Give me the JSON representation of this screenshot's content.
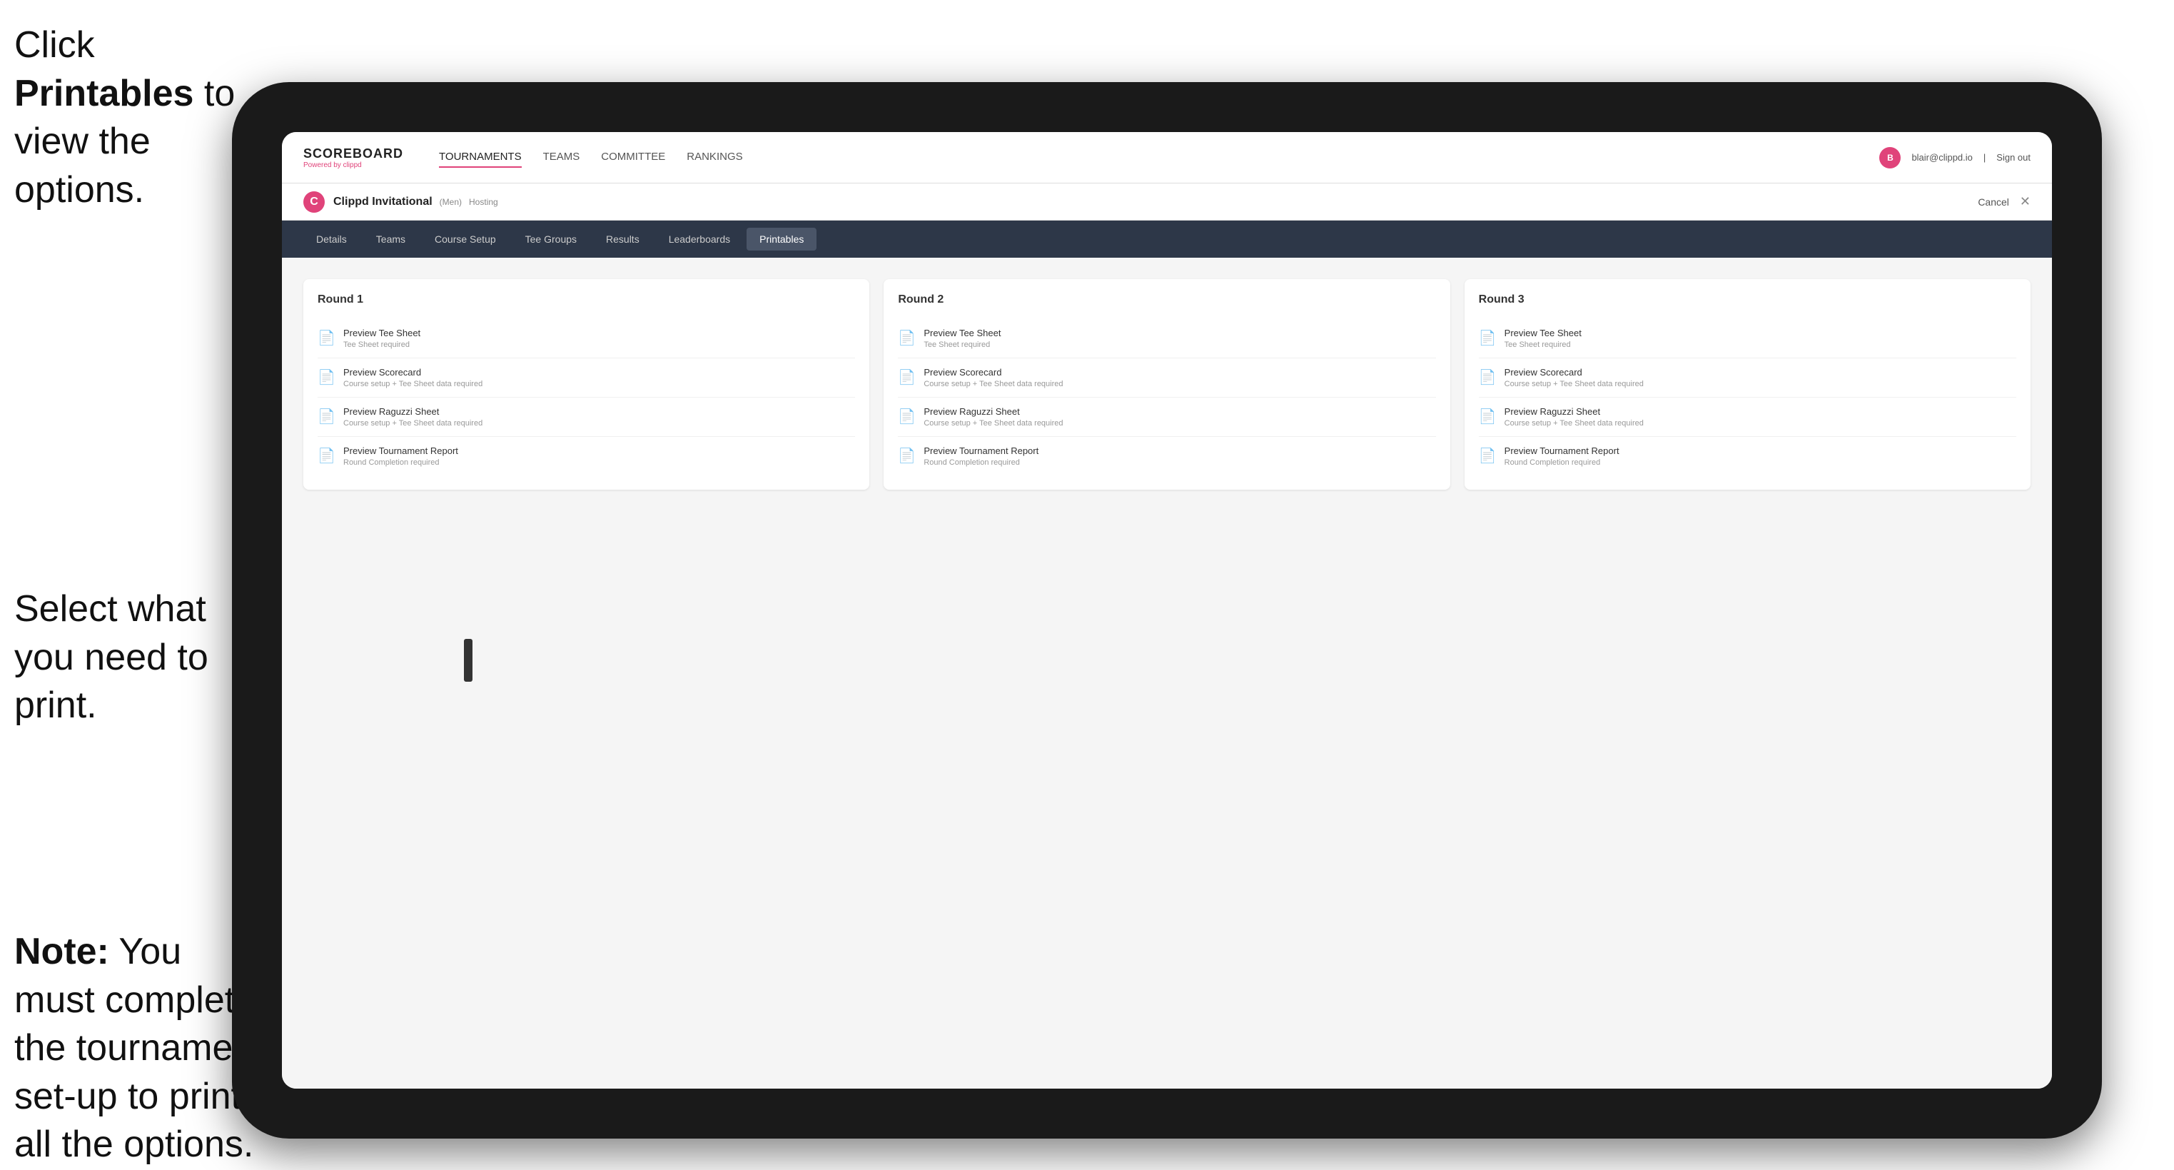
{
  "instructions": {
    "top": "Click ",
    "top_bold": "Printables",
    "top_end": " to view the options.",
    "middle": "Select what you need to print.",
    "bottom_bold": "Note:",
    "bottom_end": " You must complete the tournament set-up to print all the options."
  },
  "nav": {
    "logo": "SCOREBOARD",
    "logo_sub": "Powered by clippd",
    "items": [
      {
        "label": "TOURNAMENTS",
        "active": true
      },
      {
        "label": "TEAMS"
      },
      {
        "label": "COMMITTEE"
      },
      {
        "label": "RANKINGS"
      }
    ],
    "user_email": "blair@clippd.io",
    "sign_out": "Sign out"
  },
  "sub_header": {
    "tournament": "Clippd Invitational",
    "meta": "(Men)",
    "status": "Hosting",
    "cancel": "Cancel"
  },
  "tabs": [
    {
      "label": "Details"
    },
    {
      "label": "Teams"
    },
    {
      "label": "Course Setup"
    },
    {
      "label": "Tee Groups"
    },
    {
      "label": "Results"
    },
    {
      "label": "Leaderboards"
    },
    {
      "label": "Printables",
      "active": true
    }
  ],
  "rounds": [
    {
      "title": "Round 1",
      "items": [
        {
          "title": "Preview Tee Sheet",
          "subtitle": "Tee Sheet required"
        },
        {
          "title": "Preview Scorecard",
          "subtitle": "Course setup + Tee Sheet data required"
        },
        {
          "title": "Preview Raguzzi Sheet",
          "subtitle": "Course setup + Tee Sheet data required"
        },
        {
          "title": "Preview Tournament Report",
          "subtitle": "Round Completion required"
        }
      ]
    },
    {
      "title": "Round 2",
      "items": [
        {
          "title": "Preview Tee Sheet",
          "subtitle": "Tee Sheet required"
        },
        {
          "title": "Preview Scorecard",
          "subtitle": "Course setup + Tee Sheet data required"
        },
        {
          "title": "Preview Raguzzi Sheet",
          "subtitle": "Course setup + Tee Sheet data required"
        },
        {
          "title": "Preview Tournament Report",
          "subtitle": "Round Completion required"
        }
      ]
    },
    {
      "title": "Round 3",
      "items": [
        {
          "title": "Preview Tee Sheet",
          "subtitle": "Tee Sheet required"
        },
        {
          "title": "Preview Scorecard",
          "subtitle": "Course setup + Tee Sheet data required"
        },
        {
          "title": "Preview Raguzzi Sheet",
          "subtitle": "Course setup + Tee Sheet data required"
        },
        {
          "title": "Preview Tournament Report",
          "subtitle": "Round Completion required"
        }
      ]
    }
  ]
}
